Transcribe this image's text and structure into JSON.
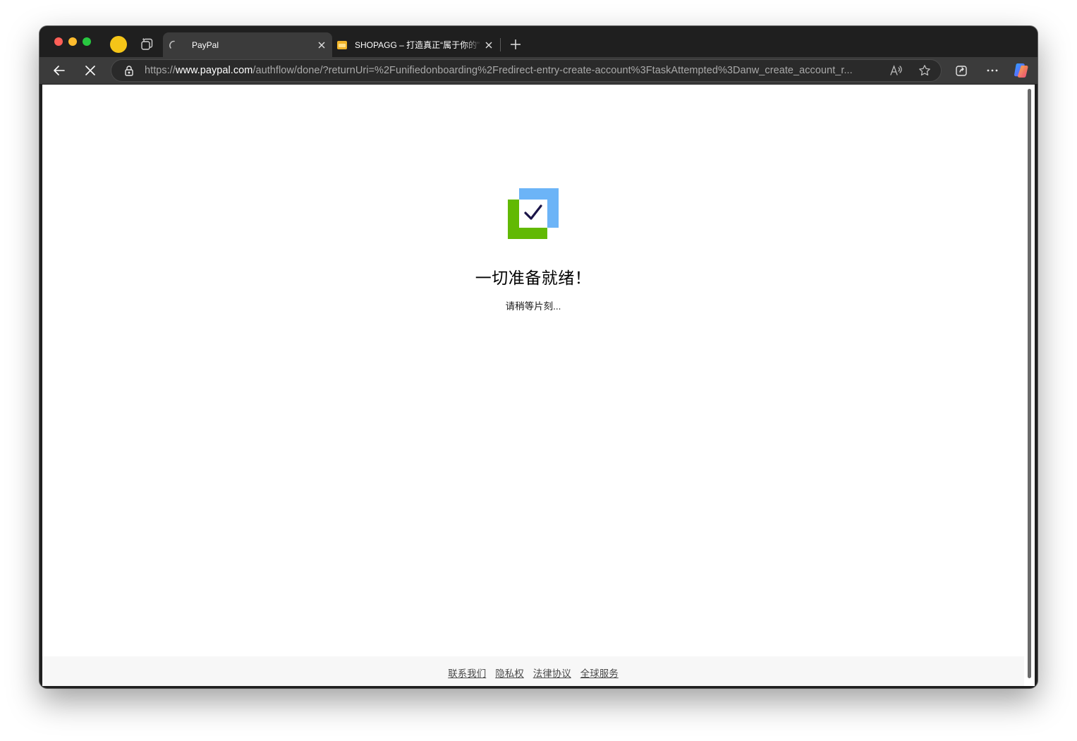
{
  "browser": {
    "tabs": [
      {
        "title": "PayPal",
        "favicon": "loading-spinner-icon",
        "active": true
      },
      {
        "title": "SHOPAGG – 打造真正“属于你的”",
        "favicon": "shopagg-favicon",
        "active": false
      }
    ],
    "address_bar": {
      "scheme": "https://",
      "domain": "www.paypal.com",
      "path": "/authflow/done/?returnUri=%2Funifiedonboarding%2Fredirect-entry-create-account%3FtaskAttempted%3Danw_create_account_r..."
    },
    "icons": {
      "back": "back-arrow-icon",
      "stop": "stop-loading-icon",
      "lock": "lock-icon",
      "read_aloud": "read-aloud-icon",
      "favorite": "star-icon",
      "share": "share-icon",
      "more": "more-icon",
      "copilot": "copilot-icon"
    },
    "colors": {
      "profile": "#f5c518"
    }
  },
  "page": {
    "title": "一切准备就绪！",
    "subtitle": "请稍等片刻...",
    "icon": "checklist-success-icon",
    "colors": {
      "accent_blue": "#6cb4f7",
      "accent_green": "#62b903",
      "check": "#1b1448"
    },
    "footer_links": [
      "联系我们",
      "隐私权",
      "法律协议",
      "全球服务"
    ]
  }
}
